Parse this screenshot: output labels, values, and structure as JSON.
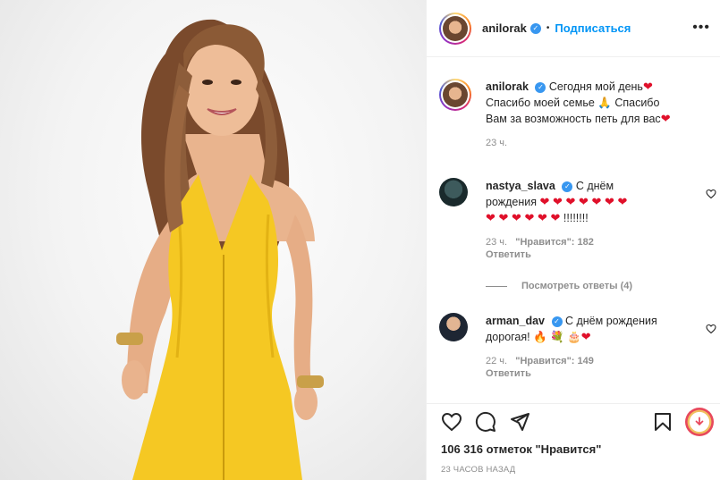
{
  "post": {
    "author": "anilorak",
    "follow_label": "Подписаться",
    "dot": "•",
    "more": "•••"
  },
  "caption": {
    "username": "anilorak",
    "line1": "Сегодня мой день",
    "line2": "Спасибо моей семье",
    "line2b": "Спасибо",
    "line3": "Вам за возможность петь для вас",
    "time": "23 ч."
  },
  "comments": [
    {
      "username": "nastya_slava",
      "text_start": "С днём",
      "text_word": "рождения",
      "hearts_row1": "❤ ❤ ❤ ❤ ❤ ❤ ❤",
      "hearts_row2": "❤ ❤ ❤ ❤ ❤ ❤",
      "exclaims": "!!!!!!!!",
      "time": "23 ч.",
      "likes": "\"Нравится\": 182",
      "reply": "Ответить"
    },
    {
      "username": "arman_dav",
      "text_start": "С днём рождения",
      "text_line2": "дорогая!",
      "emojis": "🔥 💐 🎂",
      "time": "22 ч.",
      "likes": "\"Нравится\": 149",
      "reply": "Ответить"
    }
  ],
  "view_replies": "Посмотреть ответы (4)",
  "likes_total": "106 316 отметок \"Нравится\"",
  "posted_ago": "23 ЧАСОВ НАЗАД",
  "icons": {
    "like": "heart-icon",
    "comment": "comment-icon",
    "share": "share-icon",
    "save": "bookmark-icon",
    "extension": "download-extension-icon"
  },
  "colors": {
    "accent": "#0095f6",
    "verified": "#3897f0",
    "muted": "#8e8e8e",
    "heart": "#e0102a",
    "dress": "#f5c823"
  }
}
